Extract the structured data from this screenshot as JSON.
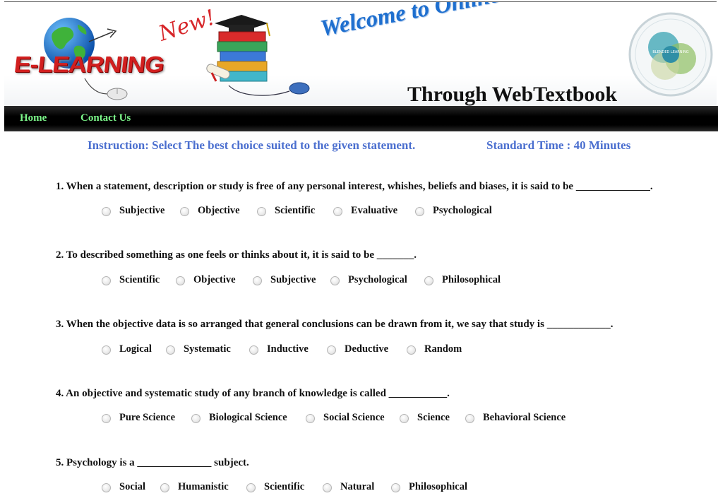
{
  "banner": {
    "logo_text": "E-LEARNING",
    "new_badge": "New!",
    "welcome_text": "Welcome to Online E-Learning",
    "through_text": "Through WebTextbook",
    "circle_label": "BLENDED LEARNING"
  },
  "nav": {
    "home": "Home",
    "contact": "Contact Us"
  },
  "instruction": "Instruction: Select The best choice suited to the given statement.",
  "standard_time": "Standard Time : 40 Minutes",
  "questions": [
    {
      "text": "1. When a statement, description or study is free of any personal interest, whishes, beliefs and biases, it is said to be ______________.",
      "options": [
        "Subjective",
        "Objective",
        "Scientific",
        "Evaluative",
        "Psychological"
      ]
    },
    {
      "text": "2. To described something as one feels or thinks about it, it is said to be _______.",
      "options": [
        "Scientific",
        "Objective",
        "Subjective",
        "Psychological",
        "Philosophical"
      ]
    },
    {
      "text": "3. When the objective data is so arranged that general conclusions can be drawn from it, we say that study is ____________.",
      "options": [
        "Logical",
        "Systematic",
        "Inductive",
        "Deductive",
        "Random"
      ]
    },
    {
      "text": "4. An objective and systematic study of any branch of knowledge is called ___________.",
      "options": [
        "Pure Science",
        "Biological Science",
        "Social Science",
        "Science",
        "Behavioral Science"
      ]
    },
    {
      "text": "5. Psychology is a ______________ subject.",
      "options": [
        "Social",
        "Humanistic",
        "Scientific",
        "Natural",
        "Philosophical"
      ]
    }
  ]
}
